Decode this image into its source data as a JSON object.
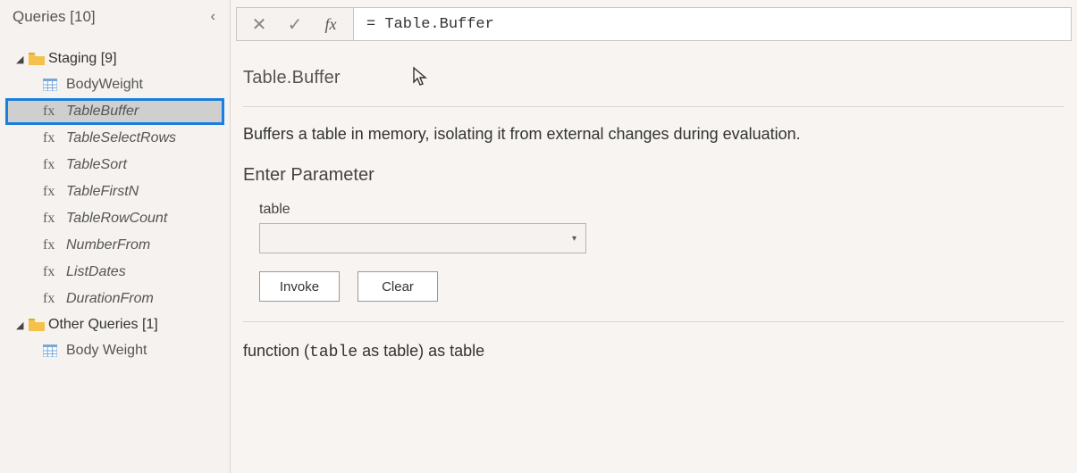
{
  "sidebar": {
    "title": "Queries",
    "count_label": "[10]",
    "groups": [
      {
        "name": "Staging",
        "count_label": "[9]",
        "items": [
          {
            "label": "BodyWeight",
            "type": "table",
            "selected": false
          },
          {
            "label": "TableBuffer",
            "type": "fx",
            "selected": true
          },
          {
            "label": "TableSelectRows",
            "type": "fx",
            "selected": false
          },
          {
            "label": "TableSort",
            "type": "fx",
            "selected": false
          },
          {
            "label": "TableFirstN",
            "type": "fx",
            "selected": false
          },
          {
            "label": "TableRowCount",
            "type": "fx",
            "selected": false
          },
          {
            "label": "NumberFrom",
            "type": "fx",
            "selected": false
          },
          {
            "label": "ListDates",
            "type": "fx",
            "selected": false
          },
          {
            "label": "DurationFrom",
            "type": "fx",
            "selected": false
          }
        ]
      },
      {
        "name": "Other Queries",
        "count_label": "[1]",
        "items": [
          {
            "label": "Body Weight",
            "type": "table",
            "selected": false
          }
        ]
      }
    ]
  },
  "formula_bar": {
    "formula": "= Table.Buffer"
  },
  "function": {
    "name": "Table.Buffer",
    "description": "Buffers a table in memory, isolating it from external changes during evaluation.",
    "param_section_title": "Enter Parameter",
    "params": [
      {
        "label": "table",
        "selected_value": ""
      }
    ],
    "buttons": {
      "invoke": "Invoke",
      "clear": "Clear"
    },
    "signature_prefix": "function (",
    "signature_param": "table",
    "signature_mid": " as table) as table"
  }
}
